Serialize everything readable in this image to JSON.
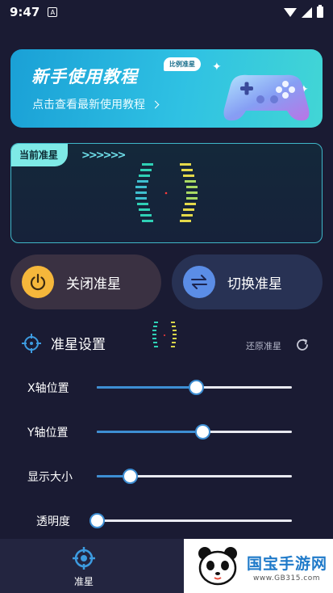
{
  "status_bar": {
    "time": "9:47",
    "notification_icon": "A"
  },
  "banner": {
    "title": "新手使用教程",
    "tag": "比例准星",
    "subtitle": "点击查看最新使用教程",
    "icon": "gamepad-icon"
  },
  "crosshair_panel": {
    "tag": "当前准星",
    "arrows": ">>>>>>"
  },
  "buttons": {
    "close_label": "关闭准星",
    "switch_label": "切换准星"
  },
  "settings": {
    "title": "准星设置",
    "reset_label": "还原准星",
    "sliders": [
      {
        "label": "X轴位置",
        "value_fraction": 0.51
      },
      {
        "label": "Y轴位置",
        "value_fraction": 0.54
      },
      {
        "label": "显示大小",
        "value_fraction": 0.17
      },
      {
        "label": "透明度",
        "value_fraction": 0.0
      }
    ]
  },
  "bottom_nav": {
    "items": [
      {
        "label": "准星",
        "icon": "crosshair-icon",
        "active": true
      }
    ]
  },
  "watermark": {
    "name": "国宝手游网",
    "url": "www.GB315.com"
  },
  "colors": {
    "background": "#1a1b33",
    "accent": "#3d8ed3",
    "panel_border": "#3fb7c8",
    "close_icon_bg": "#f5b73b",
    "switch_icon_bg": "#5b8de6"
  }
}
